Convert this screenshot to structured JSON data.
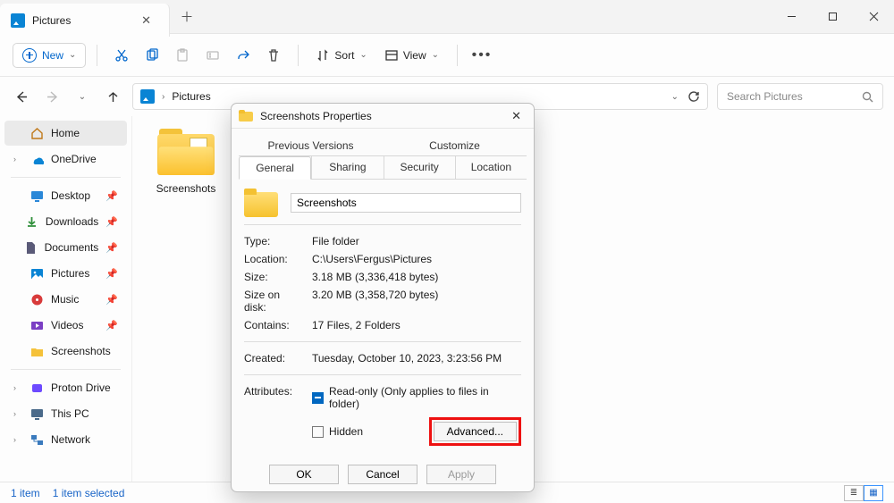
{
  "window": {
    "tab_title": "Pictures",
    "new_label": "New",
    "sort_label": "Sort",
    "view_label": "View"
  },
  "address": {
    "crumb": "Pictures",
    "search_placeholder": "Search Pictures"
  },
  "nav": {
    "home": "Home",
    "onedrive": "OneDrive",
    "desktop": "Desktop",
    "downloads": "Downloads",
    "documents": "Documents",
    "pictures": "Pictures",
    "music": "Music",
    "videos": "Videos",
    "screenshots": "Screenshots",
    "proton": "Proton Drive",
    "thispc": "This PC",
    "network": "Network"
  },
  "content": {
    "item_caption": "Screenshots"
  },
  "status": {
    "count": "1 item",
    "selected": "1 item selected"
  },
  "dialog": {
    "title": "Screenshots Properties",
    "tabs2": {
      "prev": "Previous Versions",
      "cust": "Customize"
    },
    "tabs1": {
      "general": "General",
      "sharing": "Sharing",
      "security": "Security",
      "location": "Location"
    },
    "name_value": "Screenshots",
    "fields": {
      "type_k": "Type:",
      "type_v": "File folder",
      "loc_k": "Location:",
      "loc_v": "C:\\Users\\Fergus\\Pictures",
      "size_k": "Size:",
      "size_v": "3.18 MB (3,336,418 bytes)",
      "disk_k": "Size on disk:",
      "disk_v": "3.20 MB (3,358,720 bytes)",
      "cont_k": "Contains:",
      "cont_v": "17 Files, 2 Folders",
      "created_k": "Created:",
      "created_v": "Tuesday, October 10, 2023, 3:23:56 PM",
      "attr_k": "Attributes:",
      "readonly": "Read-only (Only applies to files in folder)",
      "hidden": "Hidden",
      "advanced": "Advanced..."
    },
    "buttons": {
      "ok": "OK",
      "cancel": "Cancel",
      "apply": "Apply"
    }
  }
}
